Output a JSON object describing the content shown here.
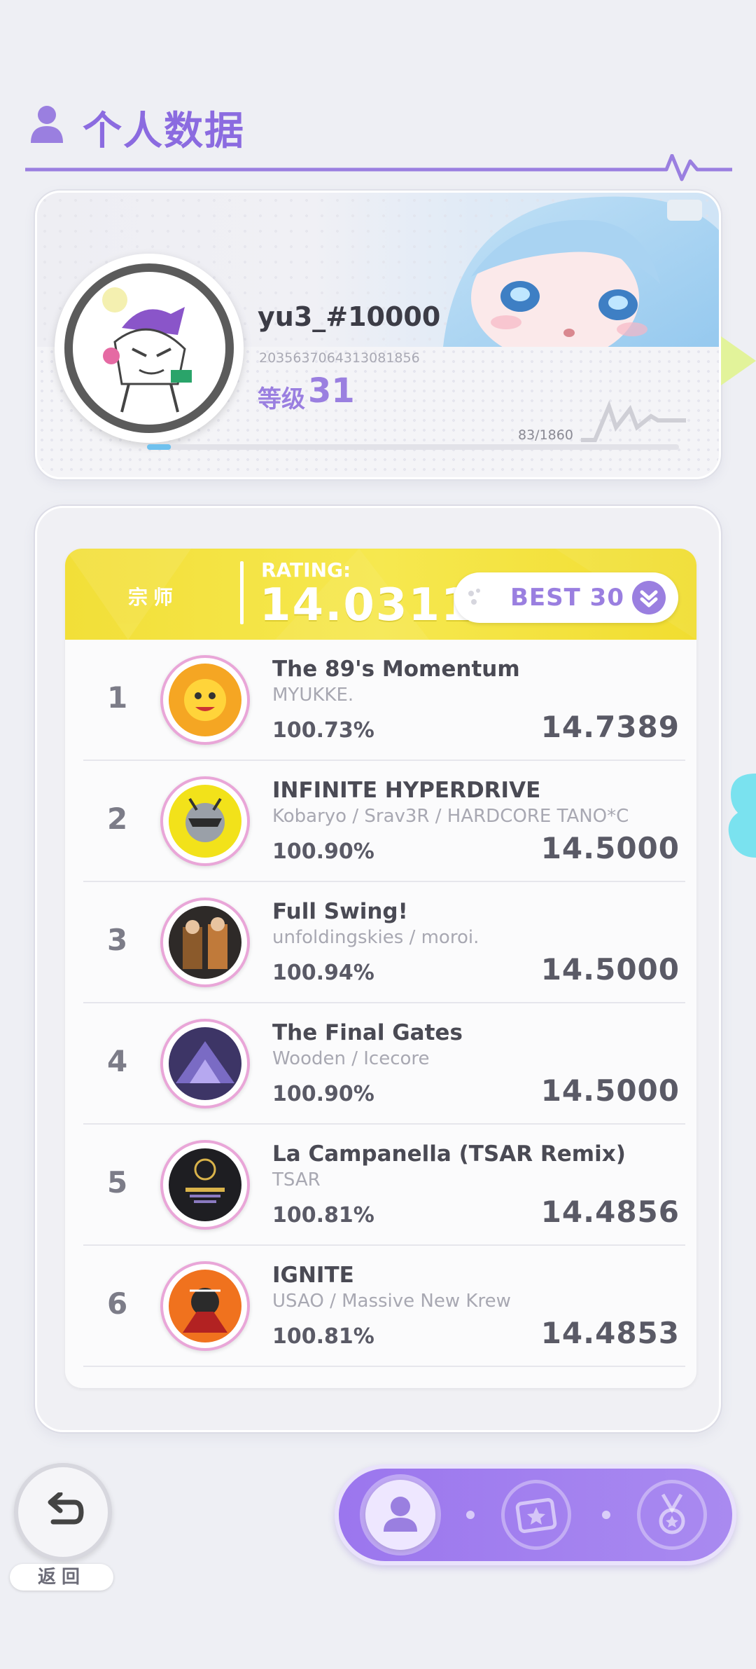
{
  "header": {
    "title": "个人数据"
  },
  "profile": {
    "username": "yu3_#10000",
    "user_id": "2035637064313081856",
    "level_label": "等级",
    "level": "31",
    "exp_text": "83/1860",
    "exp_progress": 0.045
  },
  "rating": {
    "rank_title": "宗师",
    "label": "RATING:",
    "value": "14.0311",
    "best_button": "BEST 30"
  },
  "songs": [
    {
      "rank": "1",
      "title": "The 89's Momentum",
      "artist": "MYUKKE.",
      "accuracy": "100.73%",
      "rating": "14.7389"
    },
    {
      "rank": "2",
      "title": "INFINITE HYPERDRIVE",
      "artist": "Kobaryo / Srav3R / HARDCORE TANO*C",
      "accuracy": "100.90%",
      "rating": "14.5000"
    },
    {
      "rank": "3",
      "title": "Full Swing!",
      "artist": "unfoldingskies / moroi.",
      "accuracy": "100.94%",
      "rating": "14.5000"
    },
    {
      "rank": "4",
      "title": "The Final Gates",
      "artist": "Wooden / Icecore",
      "accuracy": "100.90%",
      "rating": "14.5000"
    },
    {
      "rank": "5",
      "title": "La Campanella (TSAR Remix)",
      "artist": "TSAR",
      "accuracy": "100.81%",
      "rating": "14.4856"
    },
    {
      "rank": "6",
      "title": "IGNITE",
      "artist": "USAO / Massive New Krew",
      "accuracy": "100.81%",
      "rating": "14.4853"
    }
  ],
  "bottom": {
    "back_label": "返回"
  },
  "colors": {
    "accent": "#9a7fe0",
    "rating_yellow": "#f2df38",
    "jacket_ring": "#e9a6d8"
  }
}
